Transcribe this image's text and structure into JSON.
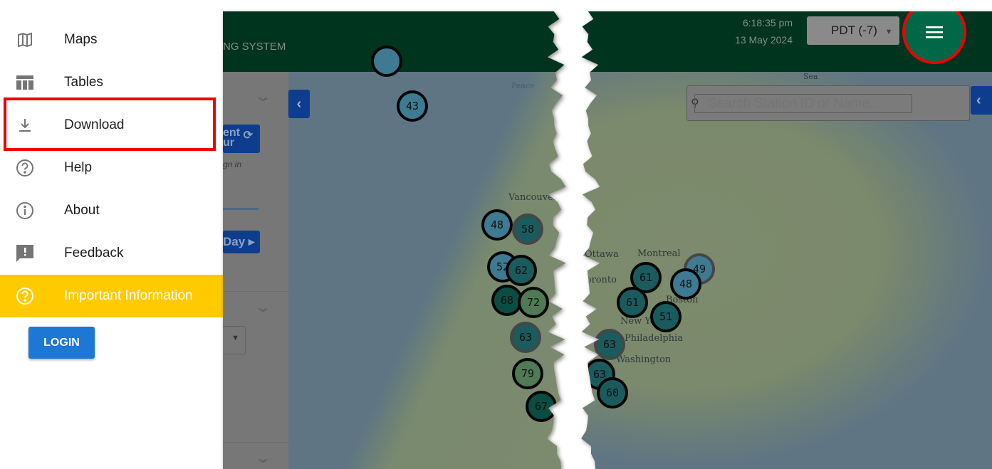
{
  "drawer": {
    "items": [
      {
        "label": "Maps",
        "icon": "map-icon"
      },
      {
        "label": "Tables",
        "icon": "table-icon"
      },
      {
        "label": "Download",
        "icon": "download-icon"
      },
      {
        "label": "Help",
        "icon": "help-circle-icon"
      },
      {
        "label": "About",
        "icon": "info-icon"
      },
      {
        "label": "Feedback",
        "icon": "feedback-icon"
      },
      {
        "label": "Important Information",
        "icon": "help-circle-icon"
      }
    ],
    "login_label": "LOGIN",
    "highlight_color": "#e00000",
    "important_color": "#ffcb00"
  },
  "header": {
    "title_fragment": "NG SYSTEM",
    "time": "6:18:35 pm",
    "date": "13 May 2024",
    "timezone": "PDT (-7)",
    "bg_color": "#00341f",
    "menu_button_color": "#006847"
  },
  "left_panel": {
    "refresh_fragment_1": "ent",
    "refresh_fragment_2": "ur",
    "signin_fragment": "gn in",
    "day_fragment": "Day"
  },
  "search": {
    "placeholder": "Search Station ID or Name..."
  },
  "map": {
    "labels": [
      "Peace",
      "Vancouver",
      "Sea",
      "Ottawa",
      "Montreal",
      "Toronto",
      "New York",
      "Boston",
      "Philadelphia",
      "Washington"
    ],
    "left_markers": [
      "43",
      "48",
      "58",
      "52",
      "62",
      "68",
      "72",
      "63",
      "79",
      "67"
    ],
    "right_markers": [
      "61",
      "49",
      "48",
      "61",
      "51",
      "63",
      "63",
      "60"
    ]
  }
}
